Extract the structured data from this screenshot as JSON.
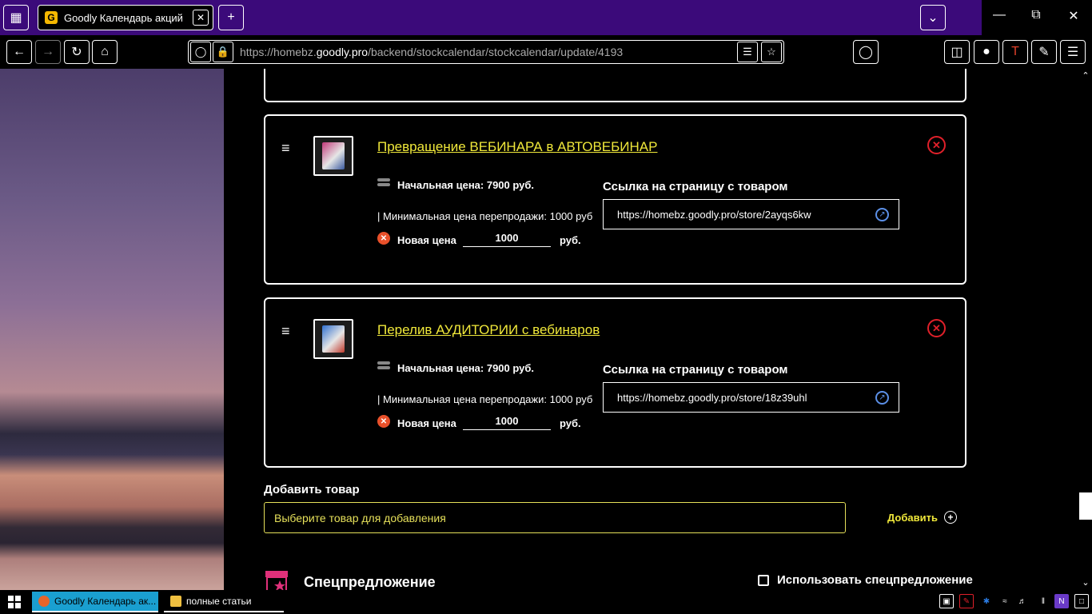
{
  "browser": {
    "tab_title": "Goodly Календарь акций",
    "tab_favicon": "G",
    "url_prefix": "https://homebz.",
    "url_domain": "goodly.pro",
    "url_path": "/backend/stockcalendar/stockcalendar/update/4193"
  },
  "products": [
    {
      "name": "Превращение ВЕБИНАРА в АВТОВЕБИНАР",
      "start_price": "Начальная цена: 7900 руб.",
      "min_price": "| Минимальная цена перепродажи: 1000 руб",
      "new_price_label": "Новая цена",
      "new_price": "1000",
      "currency": "руб.",
      "link_label": "Ссылка на страницу с товаром",
      "link": "https://homebz.goodly.pro/store/2ayqs6kw"
    },
    {
      "name": "Перелив АУДИТОРИИ с вебинаров",
      "start_price": "Начальная цена: 7900 руб.",
      "min_price": "| Минимальная цена перепродажи: 1000 руб",
      "new_price_label": "Новая цена",
      "new_price": "1000",
      "currency": "руб.",
      "link_label": "Ссылка на страницу с товаром",
      "link": "https://homebz.goodly.pro/store/18z39uhl"
    }
  ],
  "add_product": {
    "label": "Добавить товар",
    "placeholder": "Выберите товар для добавления",
    "button": "Добавить"
  },
  "special_offer": {
    "label": "Спецпредложение",
    "checkbox_label": "Использовать спецпредложение"
  },
  "taskbar": {
    "items": [
      "Goodly Календарь ак...",
      "полные статьи"
    ]
  },
  "colors": {
    "tabbar": "#3b0a7a",
    "link_yellow": "#f0e83a",
    "remove_red": "#e0202a",
    "taskbar_active": "#1a9fd0"
  }
}
